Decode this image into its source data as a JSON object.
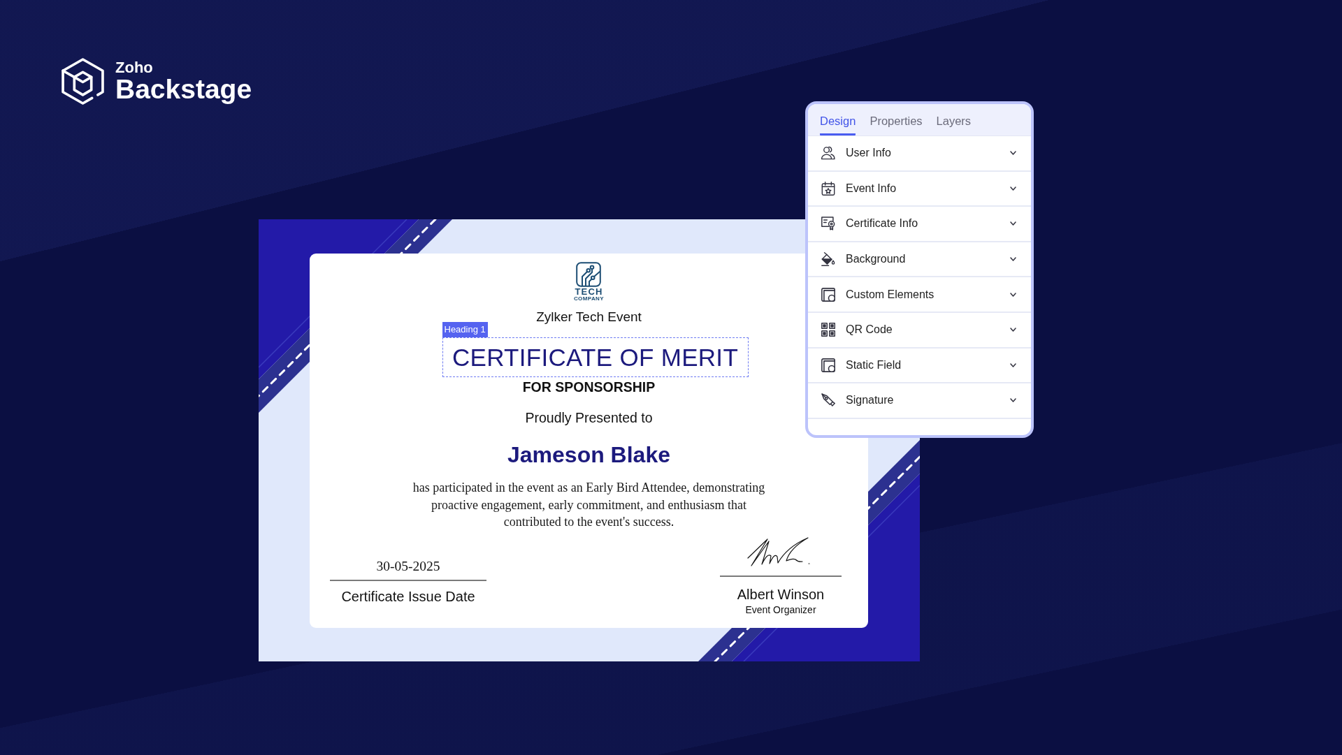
{
  "brand": {
    "company": "Zoho",
    "product": "Backstage"
  },
  "certificate": {
    "logo": {
      "title": "TECH",
      "subtitle": "COMPANY"
    },
    "event": "Zylker Tech Event",
    "heading": {
      "text": "CERTIFICATE OF MERIT",
      "selected": true,
      "tag": "Heading 1"
    },
    "subtitle": "FOR SPONSORSHIP",
    "presented": "Proudly Presented to",
    "recipient": "Jameson Blake",
    "description": "has participated in the event as an Early Bird Attendee, demonstrating proactive engagement, early commitment, and enthusiasm that contributed to the event's success.",
    "date": {
      "value": "30-05-2025",
      "label": "Certificate Issue Date"
    },
    "signatory": {
      "name": "Albert Winson",
      "role": "Event Organizer"
    }
  },
  "panel": {
    "tabs": [
      {
        "label": "Design",
        "selected": true
      },
      {
        "label": "Properties",
        "selected": false
      },
      {
        "label": "Layers",
        "selected": false
      }
    ],
    "sections": [
      {
        "label": "User Info",
        "expanded": false
      },
      {
        "label": "Event Info",
        "expanded": false
      },
      {
        "label": "Certificate Info",
        "expanded": false
      },
      {
        "label": "Background",
        "expanded": false
      },
      {
        "label": "Custom Elements",
        "expanded": false
      },
      {
        "label": "QR Code",
        "expanded": false
      },
      {
        "label": "Static Field",
        "expanded": false
      },
      {
        "label": "Signature",
        "expanded": false
      }
    ]
  }
}
